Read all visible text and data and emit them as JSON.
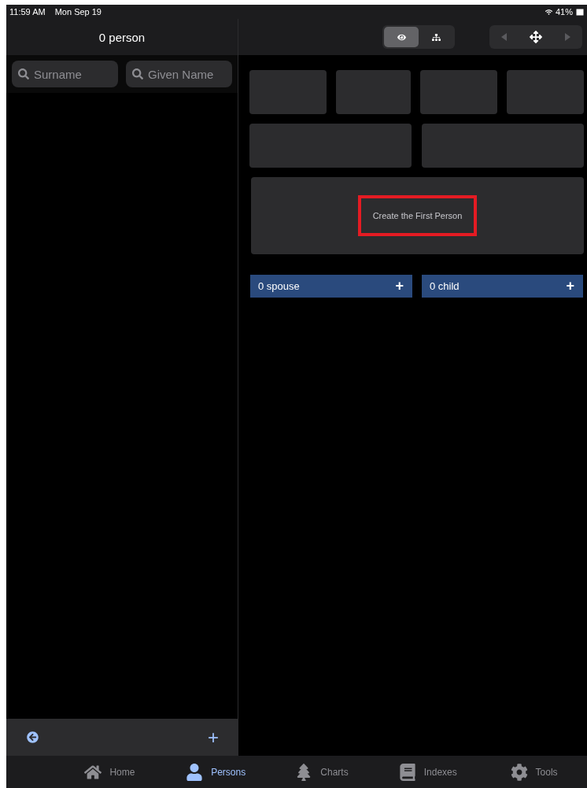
{
  "status_bar": {
    "time": "11:59 AM",
    "date": "Mon Sep 19",
    "battery": "41%"
  },
  "list_panel": {
    "title": "0 person",
    "search_fields": [
      {
        "placeholder": "Surname"
      },
      {
        "placeholder": "Given Name"
      }
    ]
  },
  "view_modes": [
    {
      "kind": "eye",
      "selected": true
    },
    {
      "kind": "tree",
      "selected": false
    }
  ],
  "navigation": {
    "back_disabled": true,
    "forward_disabled": true
  },
  "detail": {
    "create_prompt": "Create the First Person",
    "highlighted": true
  },
  "relations": [
    {
      "label": "0 spouse",
      "add": "+"
    },
    {
      "label": "0 child",
      "add": "+"
    }
  ],
  "bottom_toolbar": {
    "add": "+"
  },
  "tabs": [
    {
      "kind": "home",
      "label": "Home",
      "selected": false
    },
    {
      "kind": "person",
      "label": "Persons",
      "selected": true
    },
    {
      "kind": "tree",
      "label": "Charts",
      "selected": false
    },
    {
      "kind": "book",
      "label": "Indexes",
      "selected": false
    },
    {
      "kind": "gear",
      "label": "Tools",
      "selected": false
    }
  ]
}
